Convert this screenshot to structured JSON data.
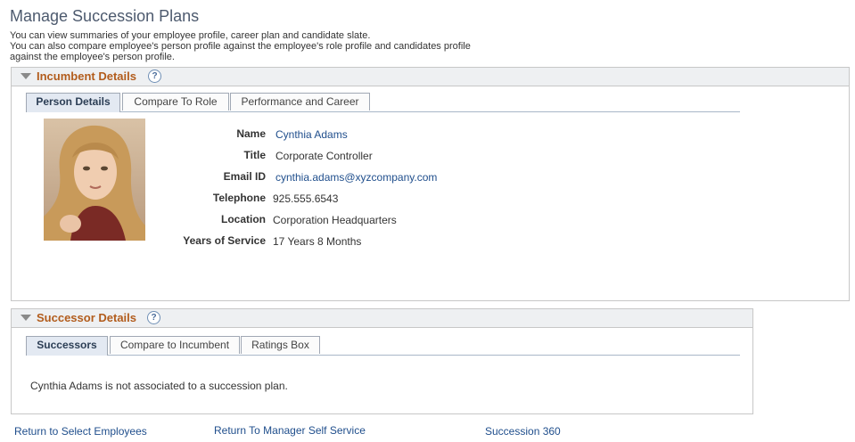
{
  "page": {
    "title": "Manage Succession Plans",
    "intro": [
      "You can view summaries of your employee profile, career plan and candidate slate.",
      "You can also compare employee's person profile against the employee's role profile and candidates profile",
      "against the employee's person profile."
    ]
  },
  "incumbent": {
    "section_title": "Incumbent Details",
    "help": "?",
    "tabs": [
      "Person Details",
      "Compare To Role",
      "Performance and Career"
    ],
    "active_tab": "Person Details",
    "photo": "employee-photo",
    "fields": [
      {
        "label": "Name",
        "value": "Cynthia Adams"
      },
      {
        "label": "Title",
        "value": "Corporate Controller"
      },
      {
        "label": "Email ID",
        "value": "cynthia.adams@xyzcompany.com"
      },
      {
        "label": "Telephone",
        "value": "925.555.6543"
      },
      {
        "label": "Location",
        "value": "Corporation Headquarters"
      },
      {
        "label": "Years of Service",
        "value": "17 Years 8 Months"
      }
    ]
  },
  "successor": {
    "section_title": "Successor Details",
    "help": "?",
    "tabs": [
      "Successors",
      "Compare to Incumbent",
      "Ratings Box"
    ],
    "active_tab": "Successors",
    "message": "Cynthia Adams is not associated to a succession plan."
  },
  "links": [
    "Return to Select Employees",
    "Return To Manager Self Service",
    "Succession 360"
  ],
  "colors": {
    "accent_title": "#b25c1c",
    "link": "#1f4e8c",
    "page_title": "#4d5a6e",
    "active_tab": "#e3e9f2"
  }
}
